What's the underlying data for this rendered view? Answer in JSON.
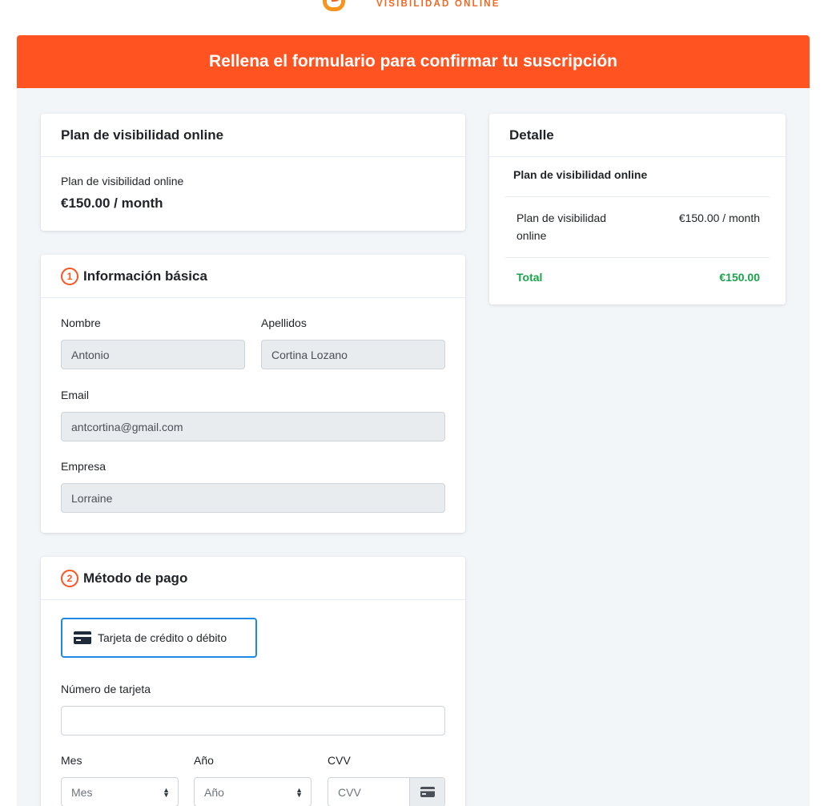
{
  "brand": {
    "tagline": "VISIBILIDAD ONLINE",
    "accent": "#ff5322",
    "logo_orange": "#f7941d"
  },
  "banner": {
    "title": "Rellena el formulario para confirmar tu suscripción"
  },
  "plan_card": {
    "title": "Plan de visibilidad online",
    "plan_name": "Plan de visibilidad online",
    "price": "€150.00 / month"
  },
  "basic_info": {
    "step": "1",
    "title": "Información básica",
    "first_name_label": "Nombre",
    "first_name_value": "Antonio",
    "last_name_label": "Apellidos",
    "last_name_value": "Cortina Lozano",
    "email_label": "Email",
    "email_value": "antcortina@gmail.com",
    "company_label": "Empresa",
    "company_value": "Lorraine"
  },
  "payment": {
    "step": "2",
    "title": "Método de pago",
    "method_label": "Tarjeta de crédito o débito",
    "card_number_label": "Número de tarjeta",
    "card_number_value": "",
    "month_label": "Mes",
    "month_selected": "Mes",
    "year_label": "Año",
    "year_selected": "Año",
    "cvv_label": "CVV",
    "cvv_placeholder": "CVV"
  },
  "detail": {
    "title": "Detalle",
    "section_title": "Plan de visibilidad online",
    "item_name": "Plan de visibilidad online",
    "item_price": "€150.00 / month",
    "total_label": "Total",
    "total_value": "€150.00",
    "total_color": "#1aa34a"
  }
}
